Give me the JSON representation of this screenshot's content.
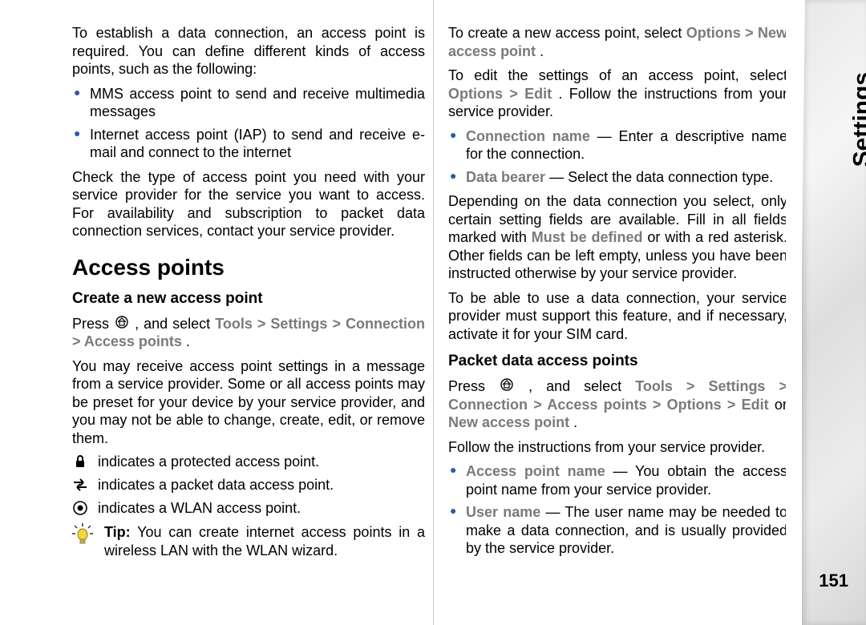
{
  "tab": {
    "label": "Settings",
    "page_number": "151"
  },
  "left": {
    "intro": "To establish a data connection, an access point is required. You can define different kinds of access points, such as the following:",
    "bullets": [
      "MMS access point to send and receive multimedia messages",
      "Internet access point (IAP) to send and receive e-mail and connect to the internet"
    ],
    "para2": "Check the type of access point you need with your service provider for the service you want to access. For availability and subscription to packet data connection services, contact your service provider.",
    "h1": "Access points",
    "h2": "Create a new access point",
    "press_prefix": "Press ",
    "press_mid": " , and select ",
    "nav_tools": "Tools",
    "nav_settings": "Settings",
    "nav_connection": "Connection",
    "nav_ap": "Access points",
    "gt": " > ",
    "period": ".",
    "para3": "You may receive access point settings in a message from a service provider. Some or all access points may be preset for your device by your service provider, and you may not be able to change, create, edit, or remove them.",
    "icon_lines": [
      " indicates a protected access point.",
      " indicates a packet data access point.",
      " indicates a WLAN access point."
    ],
    "tip_label": "Tip:",
    "tip_text": " You can create internet access points in a wireless LAN with the WLAN wizard."
  },
  "right": {
    "para1_a": "To create a new access point, select ",
    "para1_opt": "Options",
    "gt": " > ",
    "para1_new": "New access point",
    "period": ".",
    "para2_a": "To edit the settings of an access point, select ",
    "para2_edit": "Edit",
    "para2_b": ". Follow the instructions from your service provider.",
    "bullet1_key": "Connection name",
    "bullet1_txt": " — Enter a descriptive name for the connection.",
    "bullet2_key": "Data bearer",
    "bullet2_txt": " — Select the data connection type.",
    "para3_a": "Depending on the data connection you select, only certain setting fields are available. Fill in all fields marked with ",
    "para3_must": "Must be defined",
    "para3_b": " or with a red asterisk. Other fields can be left empty, unless you have been instructed otherwise by your service provider.",
    "para4": "To be able to use a data connection, your service provider must support this feature, and if necessary, activate it for your SIM card.",
    "h2": "Packet data access points",
    "press_prefix": "Press ",
    "press_mid": " , and select ",
    "nav_tools": "Tools",
    "nav_settings": "Settings",
    "nav_connection": "Connection",
    "nav_ap": "Access points",
    "nav_options": "Options",
    "nav_edit": "Edit",
    "nav_or": " or ",
    "nav_new": "New access point",
    "follow": "Follow the instructions from your service provider.",
    "b1_key": "Access point name",
    "b1_txt": " — You obtain the access point name from your service provider.",
    "b2_key": "User name",
    "b2_txt": " — The user name may be needed to make a data connection, and is usually provided by the service provider."
  }
}
